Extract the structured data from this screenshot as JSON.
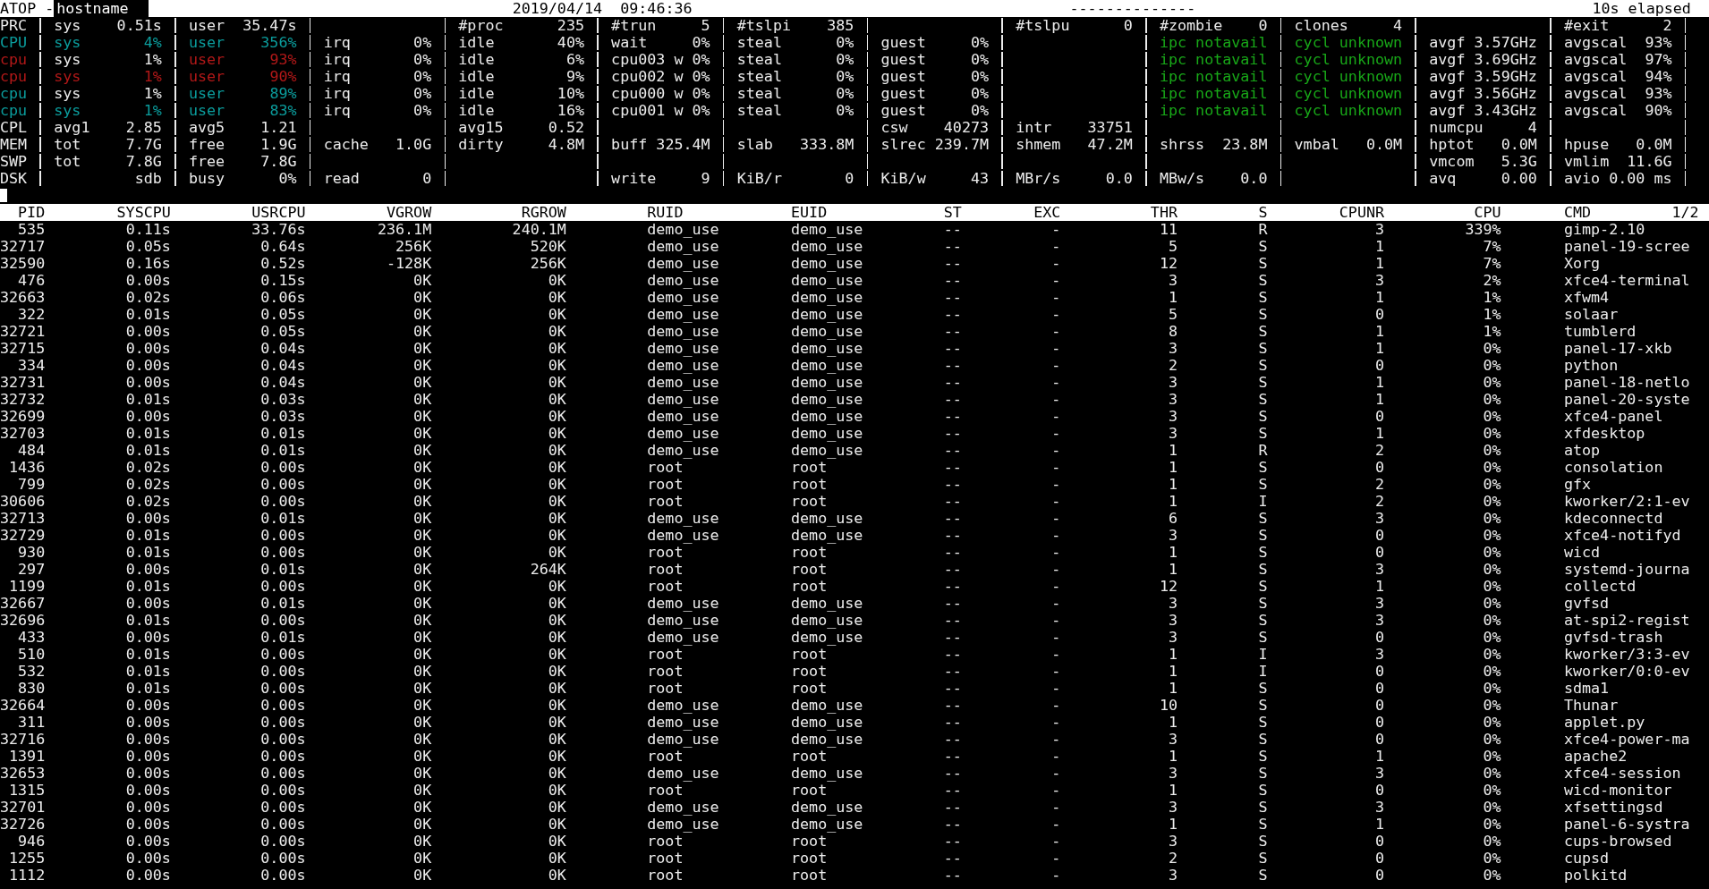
{
  "title_bar": {
    "program": "ATOP -",
    "host": "hostname",
    "datetime": "2019/04/14  09:46:36",
    "separator": "--------------",
    "elapsed": "10s elapsed"
  },
  "system_rows": [
    {
      "label": {
        "text": "PRC"
      },
      "fields": [
        {
          "kind": "metric",
          "key": "sys",
          "value": "0.51s"
        },
        {
          "kind": "metric",
          "key": "user",
          "value": "35.47s"
        },
        {
          "kind": "blank"
        },
        {
          "kind": "metric",
          "key": "#proc",
          "value": "235"
        },
        {
          "kind": "metric",
          "key": "#trun",
          "value": "5"
        },
        {
          "kind": "metric",
          "key": "#tslpi",
          "value": "385"
        },
        {
          "kind": "blank"
        },
        {
          "kind": "metric",
          "key": "#tslpu",
          "value": "0"
        },
        {
          "kind": "metric",
          "key": "#zombie",
          "value": "0"
        },
        {
          "kind": "metric",
          "key": "clones",
          "value": "4"
        },
        {
          "kind": "blank"
        },
        {
          "kind": "metric",
          "key": "#exit",
          "value": "2"
        }
      ]
    },
    {
      "label": {
        "text": "CPU",
        "color": "#0b9d9d"
      },
      "fields": [
        {
          "kind": "metric",
          "key": "sys",
          "value": "4%",
          "color": "#0b9d9d"
        },
        {
          "kind": "metric",
          "key": "user",
          "value": "356%",
          "color": "#0b9d9d"
        },
        {
          "kind": "metric",
          "key": "irq",
          "value": "0%"
        },
        {
          "kind": "metric",
          "key": "idle",
          "value": "40%"
        },
        {
          "kind": "metric",
          "key": "wait",
          "value": "0%"
        },
        {
          "kind": "metric",
          "key": "steal",
          "value": "0%"
        },
        {
          "kind": "metric",
          "key": "guest",
          "value": "0%"
        },
        {
          "kind": "blank"
        },
        {
          "kind": "metric",
          "key": "ipc",
          "value": "notavail",
          "color": "#18a818"
        },
        {
          "kind": "metric",
          "key": "cycl",
          "value": "unknown",
          "color": "#18a818"
        },
        {
          "kind": "metric",
          "key": "avgf",
          "value": "3.57GHz"
        },
        {
          "kind": "metric",
          "key": "avgscal",
          "value": "93%"
        }
      ]
    },
    {
      "label": {
        "text": "cpu",
        "color": "#b21818"
      },
      "fields": [
        {
          "kind": "metric",
          "key": "sys",
          "value": "1%"
        },
        {
          "kind": "metric",
          "key": "user",
          "value": "93%",
          "color": "#b21818"
        },
        {
          "kind": "metric",
          "key": "irq",
          "value": "0%"
        },
        {
          "kind": "metric",
          "key": "idle",
          "value": "6%"
        },
        {
          "kind": "metric",
          "key": "cpu003 w",
          "value": "0%"
        },
        {
          "kind": "metric",
          "key": "steal",
          "value": "0%"
        },
        {
          "kind": "metric",
          "key": "guest",
          "value": "0%"
        },
        {
          "kind": "blank"
        },
        {
          "kind": "metric",
          "key": "ipc",
          "value": "notavail",
          "color": "#18a818"
        },
        {
          "kind": "metric",
          "key": "cycl",
          "value": "unknown",
          "color": "#18a818"
        },
        {
          "kind": "metric",
          "key": "avgf",
          "value": "3.69GHz"
        },
        {
          "kind": "metric",
          "key": "avgscal",
          "value": "97%"
        }
      ]
    },
    {
      "label": {
        "text": "cpu",
        "color": "#b21818"
      },
      "fields": [
        {
          "kind": "metric",
          "key": "sys",
          "value": "1%",
          "color": "#b21818"
        },
        {
          "kind": "metric",
          "key": "user",
          "value": "90%",
          "color": "#b21818"
        },
        {
          "kind": "metric",
          "key": "irq",
          "value": "0%"
        },
        {
          "kind": "metric",
          "key": "idle",
          "value": "9%"
        },
        {
          "kind": "metric",
          "key": "cpu002 w",
          "value": "0%"
        },
        {
          "kind": "metric",
          "key": "steal",
          "value": "0%"
        },
        {
          "kind": "metric",
          "key": "guest",
          "value": "0%"
        },
        {
          "kind": "blank"
        },
        {
          "kind": "metric",
          "key": "ipc",
          "value": "notavail",
          "color": "#18a818"
        },
        {
          "kind": "metric",
          "key": "cycl",
          "value": "unknown",
          "color": "#18a818"
        },
        {
          "kind": "metric",
          "key": "avgf",
          "value": "3.59GHz"
        },
        {
          "kind": "metric",
          "key": "avgscal",
          "value": "94%"
        }
      ]
    },
    {
      "label": {
        "text": "cpu",
        "color": "#0b9d9d"
      },
      "fields": [
        {
          "kind": "metric",
          "key": "sys",
          "value": "1%"
        },
        {
          "kind": "metric",
          "key": "user",
          "value": "89%",
          "color": "#0b9d9d"
        },
        {
          "kind": "metric",
          "key": "irq",
          "value": "0%"
        },
        {
          "kind": "metric",
          "key": "idle",
          "value": "10%"
        },
        {
          "kind": "metric",
          "key": "cpu000 w",
          "value": "0%"
        },
        {
          "kind": "metric",
          "key": "steal",
          "value": "0%"
        },
        {
          "kind": "metric",
          "key": "guest",
          "value": "0%"
        },
        {
          "kind": "blank"
        },
        {
          "kind": "metric",
          "key": "ipc",
          "value": "notavail",
          "color": "#18a818"
        },
        {
          "kind": "metric",
          "key": "cycl",
          "value": "unknown",
          "color": "#18a818"
        },
        {
          "kind": "metric",
          "key": "avgf",
          "value": "3.56GHz"
        },
        {
          "kind": "metric",
          "key": "avgscal",
          "value": "93%"
        }
      ]
    },
    {
      "label": {
        "text": "cpu",
        "color": "#0b9d9d"
      },
      "fields": [
        {
          "kind": "metric",
          "key": "sys",
          "value": "1%",
          "color": "#0b9d9d"
        },
        {
          "kind": "metric",
          "key": "user",
          "value": "83%",
          "color": "#0b9d9d"
        },
        {
          "kind": "metric",
          "key": "irq",
          "value": "0%"
        },
        {
          "kind": "metric",
          "key": "idle",
          "value": "16%"
        },
        {
          "kind": "metric",
          "key": "cpu001 w",
          "value": "0%"
        },
        {
          "kind": "metric",
          "key": "steal",
          "value": "0%"
        },
        {
          "kind": "metric",
          "key": "guest",
          "value": "0%"
        },
        {
          "kind": "blank"
        },
        {
          "kind": "metric",
          "key": "ipc",
          "value": "notavail",
          "color": "#18a818"
        },
        {
          "kind": "metric",
          "key": "cycl",
          "value": "unknown",
          "color": "#18a818"
        },
        {
          "kind": "metric",
          "key": "avgf",
          "value": "3.43GHz"
        },
        {
          "kind": "metric",
          "key": "avgscal",
          "value": "90%"
        }
      ]
    },
    {
      "label": {
        "text": "CPL"
      },
      "fields": [
        {
          "kind": "metric",
          "key": "avg1",
          "value": "2.85"
        },
        {
          "kind": "metric",
          "key": "avg5",
          "value": "1.21"
        },
        {
          "kind": "blank"
        },
        {
          "kind": "metric",
          "key": "avg15",
          "value": "0.52"
        },
        {
          "kind": "blank"
        },
        {
          "kind": "blank"
        },
        {
          "kind": "metric",
          "key": "csw",
          "value": "40273"
        },
        {
          "kind": "metric",
          "key": "intr",
          "value": "33751"
        },
        {
          "kind": "blank"
        },
        {
          "kind": "blank"
        },
        {
          "kind": "metric",
          "key": "numcpu",
          "value": "4"
        },
        {
          "kind": "blank"
        }
      ]
    },
    {
      "label": {
        "text": "MEM"
      },
      "fields": [
        {
          "kind": "metric",
          "key": "tot",
          "value": "7.7G"
        },
        {
          "kind": "metric",
          "key": "free",
          "value": "1.9G"
        },
        {
          "kind": "metric",
          "key": "cache",
          "value": "1.0G"
        },
        {
          "kind": "metric",
          "key": "dirty",
          "value": "4.8M"
        },
        {
          "kind": "metric",
          "key": "buff",
          "value": "325.4M"
        },
        {
          "kind": "metric",
          "key": "slab",
          "value": "333.8M"
        },
        {
          "kind": "metric",
          "key": "slrec",
          "value": "239.7M"
        },
        {
          "kind": "metric",
          "key": "shmem",
          "value": "47.2M"
        },
        {
          "kind": "metric",
          "key": "shrss",
          "value": "23.8M"
        },
        {
          "kind": "metric",
          "key": "vmbal",
          "value": "0.0M"
        },
        {
          "kind": "metric",
          "key": "hptot",
          "value": "0.0M"
        },
        {
          "kind": "metric",
          "key": "hpuse",
          "value": "0.0M"
        }
      ]
    },
    {
      "label": {
        "text": "SWP"
      },
      "fields": [
        {
          "kind": "metric",
          "key": "tot",
          "value": "7.8G"
        },
        {
          "kind": "metric",
          "key": "free",
          "value": "7.8G"
        },
        {
          "kind": "blank"
        },
        {
          "kind": "blank"
        },
        {
          "kind": "blank"
        },
        {
          "kind": "blank"
        },
        {
          "kind": "blank"
        },
        {
          "kind": "blank"
        },
        {
          "kind": "blank"
        },
        {
          "kind": "blank"
        },
        {
          "kind": "metric",
          "key": "vmcom",
          "value": "5.3G"
        },
        {
          "kind": "metric",
          "key": "vmlim",
          "value": "11.6G"
        }
      ]
    },
    {
      "label": {
        "text": "DSK"
      },
      "fields": [
        {
          "kind": "metric",
          "value": "sdb"
        },
        {
          "kind": "metric",
          "key": "busy",
          "value": "0%"
        },
        {
          "kind": "metric",
          "key": "read",
          "value": "0"
        },
        {
          "kind": "blank"
        },
        {
          "kind": "metric",
          "key": "write",
          "value": "9"
        },
        {
          "kind": "metric",
          "key": "KiB/r",
          "value": "0"
        },
        {
          "kind": "metric",
          "key": "KiB/w",
          "value": "43"
        },
        {
          "kind": "metric",
          "key": "MBr/s",
          "value": "0.0"
        },
        {
          "kind": "metric",
          "key": "MBw/s",
          "value": "0.0"
        },
        {
          "kind": "blank"
        },
        {
          "kind": "metric",
          "key": "avq",
          "value": "0.00"
        },
        {
          "kind": "metric",
          "key": "avio",
          "value": "0.00 ms"
        }
      ]
    }
  ],
  "process_table": {
    "columns": [
      "PID",
      "SYSCPU",
      "USRCPU",
      "VGROW",
      "RGROW",
      "RUID",
      "EUID",
      "ST",
      "EXC",
      "THR",
      "S",
      "CPUNR",
      "CPU",
      "CMD"
    ],
    "page": "1/2",
    "rows": [
      [
        "535",
        "0.11s",
        "33.76s",
        "236.1M",
        "240.1M",
        "demo_use",
        "demo_use",
        "--",
        "-",
        "11",
        "R",
        "3",
        "339%",
        "gimp-2.10"
      ],
      [
        "32717",
        "0.05s",
        "0.64s",
        "256K",
        "520K",
        "demo_use",
        "demo_use",
        "--",
        "-",
        "5",
        "S",
        "1",
        "7%",
        "panel-19-scree"
      ],
      [
        "32590",
        "0.16s",
        "0.52s",
        "-128K",
        "256K",
        "demo_use",
        "demo_use",
        "--",
        "-",
        "12",
        "S",
        "1",
        "7%",
        "Xorg"
      ],
      [
        "476",
        "0.00s",
        "0.15s",
        "0K",
        "0K",
        "demo_use",
        "demo_use",
        "--",
        "-",
        "3",
        "S",
        "3",
        "2%",
        "xfce4-terminal"
      ],
      [
        "32663",
        "0.02s",
        "0.06s",
        "0K",
        "0K",
        "demo_use",
        "demo_use",
        "--",
        "-",
        "1",
        "S",
        "1",
        "1%",
        "xfwm4"
      ],
      [
        "322",
        "0.01s",
        "0.05s",
        "0K",
        "0K",
        "demo_use",
        "demo_use",
        "--",
        "-",
        "5",
        "S",
        "0",
        "1%",
        "solaar"
      ],
      [
        "32721",
        "0.00s",
        "0.05s",
        "0K",
        "0K",
        "demo_use",
        "demo_use",
        "--",
        "-",
        "8",
        "S",
        "1",
        "1%",
        "tumblerd"
      ],
      [
        "32715",
        "0.00s",
        "0.04s",
        "0K",
        "0K",
        "demo_use",
        "demo_use",
        "--",
        "-",
        "3",
        "S",
        "1",
        "0%",
        "panel-17-xkb"
      ],
      [
        "334",
        "0.00s",
        "0.04s",
        "0K",
        "0K",
        "demo_use",
        "demo_use",
        "--",
        "-",
        "2",
        "S",
        "0",
        "0%",
        "python"
      ],
      [
        "32731",
        "0.00s",
        "0.04s",
        "0K",
        "0K",
        "demo_use",
        "demo_use",
        "--",
        "-",
        "3",
        "S",
        "1",
        "0%",
        "panel-18-netlo"
      ],
      [
        "32732",
        "0.01s",
        "0.03s",
        "0K",
        "0K",
        "demo_use",
        "demo_use",
        "--",
        "-",
        "3",
        "S",
        "1",
        "0%",
        "panel-20-syste"
      ],
      [
        "32699",
        "0.00s",
        "0.03s",
        "0K",
        "0K",
        "demo_use",
        "demo_use",
        "--",
        "-",
        "3",
        "S",
        "0",
        "0%",
        "xfce4-panel"
      ],
      [
        "32703",
        "0.01s",
        "0.01s",
        "0K",
        "0K",
        "demo_use",
        "demo_use",
        "--",
        "-",
        "3",
        "S",
        "1",
        "0%",
        "xfdesktop"
      ],
      [
        "484",
        "0.01s",
        "0.01s",
        "0K",
        "0K",
        "demo_use",
        "demo_use",
        "--",
        "-",
        "1",
        "R",
        "2",
        "0%",
        "atop"
      ],
      [
        "1436",
        "0.02s",
        "0.00s",
        "0K",
        "0K",
        "root",
        "root",
        "--",
        "-",
        "1",
        "S",
        "0",
        "0%",
        "consolation"
      ],
      [
        "799",
        "0.02s",
        "0.00s",
        "0K",
        "0K",
        "root",
        "root",
        "--",
        "-",
        "1",
        "S",
        "2",
        "0%",
        "gfx"
      ],
      [
        "30606",
        "0.02s",
        "0.00s",
        "0K",
        "0K",
        "root",
        "root",
        "--",
        "-",
        "1",
        "I",
        "2",
        "0%",
        "kworker/2:1-ev"
      ],
      [
        "32713",
        "0.00s",
        "0.01s",
        "0K",
        "0K",
        "demo_use",
        "demo_use",
        "--",
        "-",
        "6",
        "S",
        "3",
        "0%",
        "kdeconnectd"
      ],
      [
        "32729",
        "0.01s",
        "0.00s",
        "0K",
        "0K",
        "demo_use",
        "demo_use",
        "--",
        "-",
        "3",
        "S",
        "0",
        "0%",
        "xfce4-notifyd"
      ],
      [
        "930",
        "0.01s",
        "0.00s",
        "0K",
        "0K",
        "root",
        "root",
        "--",
        "-",
        "1",
        "S",
        "0",
        "0%",
        "wicd"
      ],
      [
        "297",
        "0.00s",
        "0.01s",
        "0K",
        "264K",
        "root",
        "root",
        "--",
        "-",
        "1",
        "S",
        "3",
        "0%",
        "systemd-journa"
      ],
      [
        "1199",
        "0.01s",
        "0.00s",
        "0K",
        "0K",
        "root",
        "root",
        "--",
        "-",
        "12",
        "S",
        "1",
        "0%",
        "collectd"
      ],
      [
        "32667",
        "0.00s",
        "0.01s",
        "0K",
        "0K",
        "demo_use",
        "demo_use",
        "--",
        "-",
        "3",
        "S",
        "3",
        "0%",
        "gvfsd"
      ],
      [
        "32696",
        "0.01s",
        "0.00s",
        "0K",
        "0K",
        "demo_use",
        "demo_use",
        "--",
        "-",
        "3",
        "S",
        "3",
        "0%",
        "at-spi2-regist"
      ],
      [
        "433",
        "0.00s",
        "0.01s",
        "0K",
        "0K",
        "demo_use",
        "demo_use",
        "--",
        "-",
        "3",
        "S",
        "0",
        "0%",
        "gvfsd-trash"
      ],
      [
        "510",
        "0.01s",
        "0.00s",
        "0K",
        "0K",
        "root",
        "root",
        "--",
        "-",
        "1",
        "I",
        "3",
        "0%",
        "kworker/3:3-ev"
      ],
      [
        "532",
        "0.01s",
        "0.00s",
        "0K",
        "0K",
        "root",
        "root",
        "--",
        "-",
        "1",
        "I",
        "0",
        "0%",
        "kworker/0:0-ev"
      ],
      [
        "830",
        "0.01s",
        "0.00s",
        "0K",
        "0K",
        "root",
        "root",
        "--",
        "-",
        "1",
        "S",
        "0",
        "0%",
        "sdma1"
      ],
      [
        "32664",
        "0.00s",
        "0.00s",
        "0K",
        "0K",
        "demo_use",
        "demo_use",
        "--",
        "-",
        "10",
        "S",
        "0",
        "0%",
        "Thunar"
      ],
      [
        "311",
        "0.00s",
        "0.00s",
        "0K",
        "0K",
        "demo_use",
        "demo_use",
        "--",
        "-",
        "1",
        "S",
        "0",
        "0%",
        "applet.py"
      ],
      [
        "32716",
        "0.00s",
        "0.00s",
        "0K",
        "0K",
        "demo_use",
        "demo_use",
        "--",
        "-",
        "3",
        "S",
        "0",
        "0%",
        "xfce4-power-ma"
      ],
      [
        "1391",
        "0.00s",
        "0.00s",
        "0K",
        "0K",
        "root",
        "root",
        "--",
        "-",
        "1",
        "S",
        "1",
        "0%",
        "apache2"
      ],
      [
        "32653",
        "0.00s",
        "0.00s",
        "0K",
        "0K",
        "demo_use",
        "demo_use",
        "--",
        "-",
        "3",
        "S",
        "3",
        "0%",
        "xfce4-session"
      ],
      [
        "1315",
        "0.00s",
        "0.00s",
        "0K",
        "0K",
        "root",
        "root",
        "--",
        "-",
        "1",
        "S",
        "0",
        "0%",
        "wicd-monitor"
      ],
      [
        "32701",
        "0.00s",
        "0.00s",
        "0K",
        "0K",
        "demo_use",
        "demo_use",
        "--",
        "-",
        "3",
        "S",
        "3",
        "0%",
        "xfsettingsd"
      ],
      [
        "32726",
        "0.00s",
        "0.00s",
        "0K",
        "0K",
        "demo_use",
        "demo_use",
        "--",
        "-",
        "1",
        "S",
        "1",
        "0%",
        "panel-6-systra"
      ],
      [
        "946",
        "0.00s",
        "0.00s",
        "0K",
        "0K",
        "root",
        "root",
        "--",
        "-",
        "3",
        "S",
        "0",
        "0%",
        "cups-browsed"
      ],
      [
        "1255",
        "0.00s",
        "0.00s",
        "0K",
        "0K",
        "root",
        "root",
        "--",
        "-",
        "2",
        "S",
        "0",
        "0%",
        "cupsd"
      ],
      [
        "1112",
        "0.00s",
        "0.00s",
        "0K",
        "0K",
        "root",
        "root",
        "--",
        "-",
        "3",
        "S",
        "0",
        "0%",
        "polkitd"
      ]
    ]
  }
}
